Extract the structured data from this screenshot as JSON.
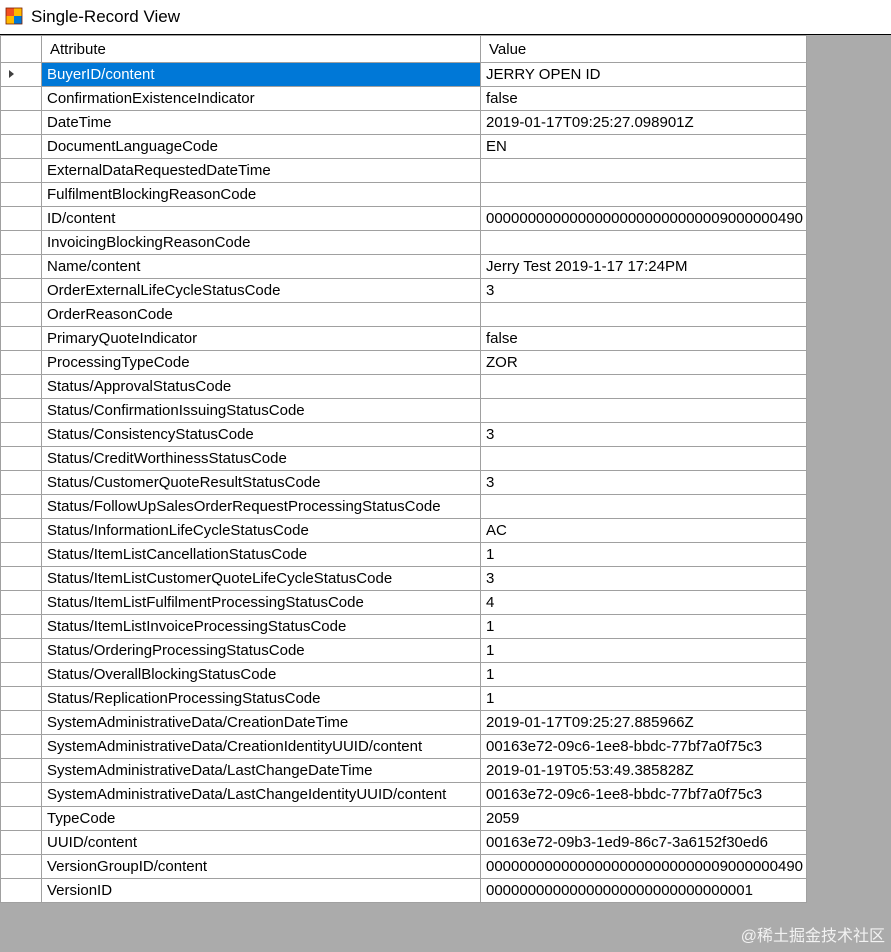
{
  "window": {
    "title": "Single-Record View",
    "icon": "windows-form-icon"
  },
  "grid": {
    "columns": [
      "Attribute",
      "Value"
    ],
    "rows": [
      {
        "attr": "BuyerID/content",
        "val": "JERRY OPEN ID"
      },
      {
        "attr": "ConfirmationExistenceIndicator",
        "val": "false"
      },
      {
        "attr": "DateTime",
        "val": "2019-01-17T09:25:27.098901Z"
      },
      {
        "attr": "DocumentLanguageCode",
        "val": "EN"
      },
      {
        "attr": "ExternalDataRequestedDateTime",
        "val": ""
      },
      {
        "attr": "FulfilmentBlockingReasonCode",
        "val": ""
      },
      {
        "attr": "ID/content",
        "val": "00000000000000000000000000009000000490"
      },
      {
        "attr": "InvoicingBlockingReasonCode",
        "val": ""
      },
      {
        "attr": "Name/content",
        "val": "Jerry Test 2019-1-17 17:24PM"
      },
      {
        "attr": "OrderExternalLifeCycleStatusCode",
        "val": "3"
      },
      {
        "attr": "OrderReasonCode",
        "val": ""
      },
      {
        "attr": "PrimaryQuoteIndicator",
        "val": "false"
      },
      {
        "attr": "ProcessingTypeCode",
        "val": "ZOR"
      },
      {
        "attr": "Status/ApprovalStatusCode",
        "val": ""
      },
      {
        "attr": "Status/ConfirmationIssuingStatusCode",
        "val": ""
      },
      {
        "attr": "Status/ConsistencyStatusCode",
        "val": "3"
      },
      {
        "attr": "Status/CreditWorthinessStatusCode",
        "val": ""
      },
      {
        "attr": "Status/CustomerQuoteResultStatusCode",
        "val": "3"
      },
      {
        "attr": "Status/FollowUpSalesOrderRequestProcessingStatusCode",
        "val": ""
      },
      {
        "attr": "Status/InformationLifeCycleStatusCode",
        "val": "AC"
      },
      {
        "attr": "Status/ItemListCancellationStatusCode",
        "val": "1"
      },
      {
        "attr": "Status/ItemListCustomerQuoteLifeCycleStatusCode",
        "val": "3"
      },
      {
        "attr": "Status/ItemListFulfilmentProcessingStatusCode",
        "val": "4"
      },
      {
        "attr": "Status/ItemListInvoiceProcessingStatusCode",
        "val": "1"
      },
      {
        "attr": "Status/OrderingProcessingStatusCode",
        "val": "1"
      },
      {
        "attr": "Status/OverallBlockingStatusCode",
        "val": "1"
      },
      {
        "attr": "Status/ReplicationProcessingStatusCode",
        "val": "1"
      },
      {
        "attr": "SystemAdministrativeData/CreationDateTime",
        "val": "2019-01-17T09:25:27.885966Z"
      },
      {
        "attr": "SystemAdministrativeData/CreationIdentityUUID/content",
        "val": "00163e72-09c6-1ee8-bbdc-77bf7a0f75c3"
      },
      {
        "attr": "SystemAdministrativeData/LastChangeDateTime",
        "val": "2019-01-19T05:53:49.385828Z"
      },
      {
        "attr": "SystemAdministrativeData/LastChangeIdentityUUID/content",
        "val": "00163e72-09c6-1ee8-bbdc-77bf7a0f75c3"
      },
      {
        "attr": "TypeCode",
        "val": "2059"
      },
      {
        "attr": "UUID/content",
        "val": "00163e72-09b3-1ed9-86c7-3a6152f30ed6"
      },
      {
        "attr": "VersionGroupID/content",
        "val": "00000000000000000000000000009000000490"
      },
      {
        "attr": "VersionID",
        "val": "00000000000000000000000000000001"
      }
    ],
    "selected_index": 0,
    "current_row_icon": "row-pointer-icon"
  },
  "watermark": "@稀土掘金技术社区",
  "colors": {
    "selection": "#0078d7",
    "background": "#ababab",
    "gridline": "#a0a0a0"
  }
}
